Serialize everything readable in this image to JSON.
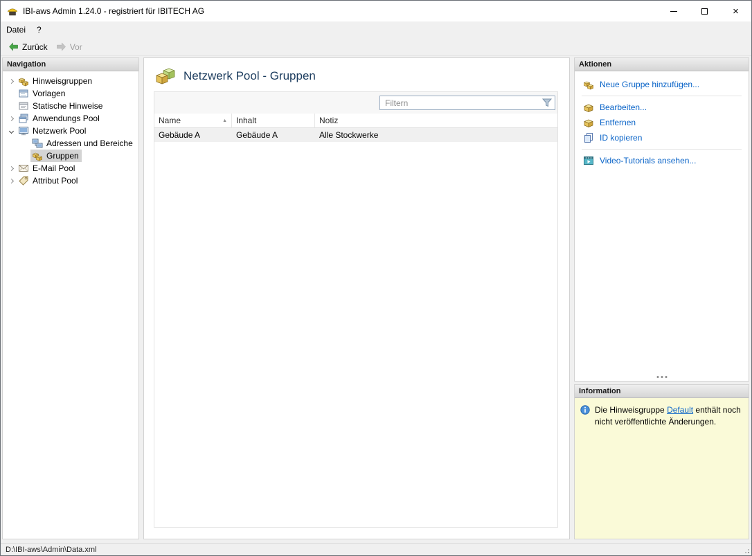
{
  "window": {
    "title": "IBI-aws Admin 1.24.0 - registriert für IBITECH AG"
  },
  "menu": {
    "items": [
      {
        "label": "Datei"
      },
      {
        "label": "?"
      }
    ]
  },
  "toolbar": {
    "back_label": "Zurück",
    "forward_label": "Vor"
  },
  "navigation": {
    "header": "Navigation",
    "items": [
      {
        "label": "Hinweisgruppen",
        "icon": "notice-groups-icon",
        "state": "collapsed"
      },
      {
        "label": "Vorlagen",
        "icon": "templates-icon",
        "state": "leaf"
      },
      {
        "label": "Statische Hinweise",
        "icon": "static-notices-icon",
        "state": "leaf"
      },
      {
        "label": "Anwendungs Pool",
        "icon": "application-pool-icon",
        "state": "collapsed"
      },
      {
        "label": "Netzwerk Pool",
        "icon": "network-pool-icon",
        "state": "expanded"
      },
      {
        "label": "Adressen und Bereiche",
        "icon": "addresses-icon",
        "state": "leaf",
        "child": true
      },
      {
        "label": "Gruppen",
        "icon": "groups-icon",
        "state": "leaf",
        "child": true,
        "selected": true
      },
      {
        "label": "E-Mail Pool",
        "icon": "email-pool-icon",
        "state": "collapsed"
      },
      {
        "label": "Attribut Pool",
        "icon": "attribute-pool-icon",
        "state": "collapsed"
      }
    ]
  },
  "main": {
    "title": "Netzwerk Pool - Gruppen",
    "filter": {
      "placeholder": "Filtern"
    },
    "table": {
      "columns": [
        "Name",
        "Inhalt",
        "Notiz"
      ],
      "sorted_column": "Name",
      "sort_direction": "ascending",
      "rows": [
        [
          "Gebäude A",
          "Gebäude A",
          "Alle Stockwerke"
        ]
      ]
    }
  },
  "actions": {
    "header": "Aktionen",
    "items": [
      {
        "label": "Neue Gruppe hinzufügen...",
        "icon": "add-group-icon",
        "group": 1
      },
      {
        "label": "Bearbeiten...",
        "icon": "edit-group-icon",
        "group": 2
      },
      {
        "label": "Entfernen",
        "icon": "remove-group-icon",
        "group": 2
      },
      {
        "label": "ID kopieren",
        "icon": "copy-id-icon",
        "group": 2
      },
      {
        "label": "Video-Tutorials ansehen...",
        "icon": "video-tutorials-icon",
        "group": 3
      }
    ]
  },
  "information": {
    "header": "Information",
    "message": {
      "text_before": "Die Hinweisgruppe ",
      "link_label": "Default",
      "text_after": " enthält noch nicht veröffentlichte Änderungen."
    }
  },
  "statusbar": {
    "file_path": "D:\\IBI-aws\\Admin\\Data.xml"
  },
  "icons": {
    "sort_ascending": "▲",
    "close": "×"
  },
  "colors": {
    "action_link": "#0a64c8",
    "info_panel_bg": "#fafad8",
    "selected_row_bg": "#f0f0f0",
    "back_arrow_green": "#47a447"
  }
}
